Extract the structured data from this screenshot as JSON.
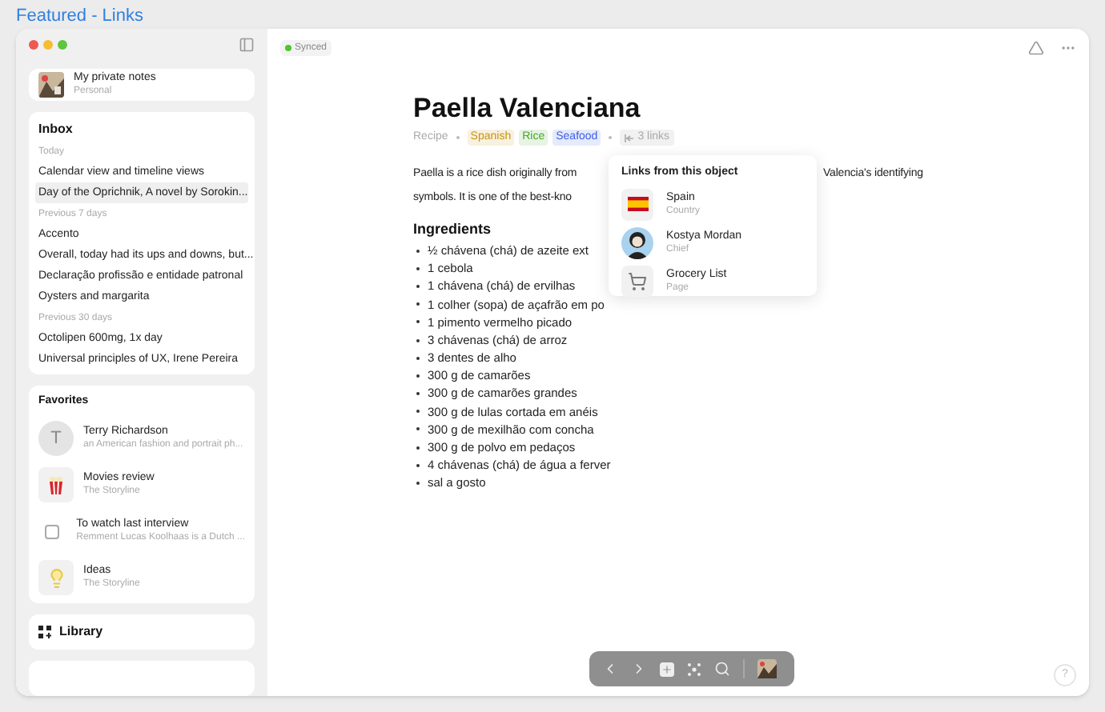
{
  "page_title": "Featured - Links",
  "sidebar": {
    "space": {
      "title": "My private notes",
      "subtitle": "Personal"
    },
    "inbox": {
      "title": "Inbox",
      "groups": [
        {
          "label": "Today",
          "items": [
            {
              "label": "Calendar view and timeline views",
              "selected": false
            },
            {
              "label": "Day of the Oprichnik, A novel by Sorokin...",
              "selected": true
            }
          ]
        },
        {
          "label": "Previous 7 days",
          "items": [
            {
              "label": "Accento",
              "selected": false
            },
            {
              "label": "Overall, today had its ups and downs, but...",
              "selected": false
            },
            {
              "label": "Declaração profissão e entidade patronal",
              "selected": false
            },
            {
              "label": "Oysters and margarita",
              "selected": false
            }
          ]
        },
        {
          "label": "Previous 30 days",
          "items": [
            {
              "label": "Octolipen 600mg, 1x day",
              "selected": false
            },
            {
              "label": "Universal principles of UX, Irene Pereira",
              "selected": false
            }
          ]
        }
      ]
    },
    "favorites": {
      "title": "Favorites",
      "items": [
        {
          "kind": "initial",
          "initial": "T",
          "title": "Terry Richardson",
          "subtitle": "an American fashion and portrait ph..."
        },
        {
          "kind": "popcorn",
          "title": "Movies review",
          "subtitle": "The Storyline"
        },
        {
          "kind": "checkbox",
          "checked": false,
          "title": "To watch last interview",
          "subtitle": "Remment Lucas Koolhaas is a Dutch ..."
        },
        {
          "kind": "bulb",
          "title": "Ideas",
          "subtitle": "The Storyline"
        }
      ]
    },
    "library": {
      "label": "Library"
    }
  },
  "status": {
    "label": "Synced",
    "color": "#4cc72c"
  },
  "document": {
    "title": "Paella Valenciana",
    "type": "Recipe",
    "tags": [
      {
        "label": "Spanish",
        "color": "#c99310"
      },
      {
        "label": "Rice",
        "color": "#48a82a"
      },
      {
        "label": "Seafood",
        "color": "#3c5ee6"
      }
    ],
    "links_count": "3 links",
    "paragraph_lines": [
      {
        "left": "Paella is a rice dish originally from",
        "right": "Valencia's identifying"
      },
      {
        "left": "symbols. It is one of the best-kno"
      }
    ],
    "section_heading": "Ingredients",
    "ingredients": [
      "½ chávena (chá) de azeite ext",
      "1 cebola",
      "1 chávena (chá) de ervilhas",
      "1 colher (sopa) de açafrão em po",
      "1 pimento vermelho picado",
      "3 chávenas (chá) de arroz",
      "3 dentes de alho",
      "300 g de camarões",
      "300 g de camarões grandes",
      "300 g de lulas cortada em anéis",
      "300 g de mexilhão com concha",
      "300 g de polvo em pedaços",
      "4 chávenas (chá) de água a ferver",
      "sal a gosto"
    ]
  },
  "links_popover": {
    "title": "Links from this object",
    "items": [
      {
        "kind": "flag",
        "title": "Spain",
        "subtitle": "Country"
      },
      {
        "kind": "person",
        "title": "Kostya Mordan",
        "subtitle": "Chief"
      },
      {
        "kind": "cart",
        "title": "Grocery List",
        "subtitle": "Page"
      }
    ]
  },
  "help": {
    "label": "?"
  }
}
